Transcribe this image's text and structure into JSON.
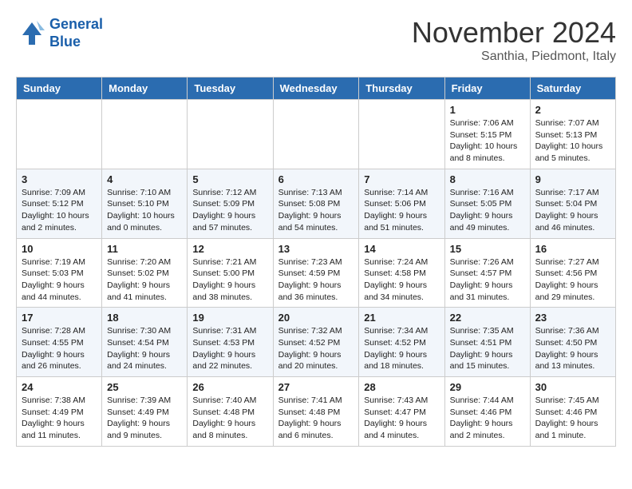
{
  "header": {
    "logo_line1": "General",
    "logo_line2": "Blue",
    "month_title": "November 2024",
    "location": "Santhia, Piedmont, Italy"
  },
  "days_of_week": [
    "Sunday",
    "Monday",
    "Tuesday",
    "Wednesday",
    "Thursday",
    "Friday",
    "Saturday"
  ],
  "weeks": [
    [
      {
        "day": "",
        "info": ""
      },
      {
        "day": "",
        "info": ""
      },
      {
        "day": "",
        "info": ""
      },
      {
        "day": "",
        "info": ""
      },
      {
        "day": "",
        "info": ""
      },
      {
        "day": "1",
        "info": "Sunrise: 7:06 AM\nSunset: 5:15 PM\nDaylight: 10 hours\nand 8 minutes."
      },
      {
        "day": "2",
        "info": "Sunrise: 7:07 AM\nSunset: 5:13 PM\nDaylight: 10 hours\nand 5 minutes."
      }
    ],
    [
      {
        "day": "3",
        "info": "Sunrise: 7:09 AM\nSunset: 5:12 PM\nDaylight: 10 hours\nand 2 minutes."
      },
      {
        "day": "4",
        "info": "Sunrise: 7:10 AM\nSunset: 5:10 PM\nDaylight: 10 hours\nand 0 minutes."
      },
      {
        "day": "5",
        "info": "Sunrise: 7:12 AM\nSunset: 5:09 PM\nDaylight: 9 hours\nand 57 minutes."
      },
      {
        "day": "6",
        "info": "Sunrise: 7:13 AM\nSunset: 5:08 PM\nDaylight: 9 hours\nand 54 minutes."
      },
      {
        "day": "7",
        "info": "Sunrise: 7:14 AM\nSunset: 5:06 PM\nDaylight: 9 hours\nand 51 minutes."
      },
      {
        "day": "8",
        "info": "Sunrise: 7:16 AM\nSunset: 5:05 PM\nDaylight: 9 hours\nand 49 minutes."
      },
      {
        "day": "9",
        "info": "Sunrise: 7:17 AM\nSunset: 5:04 PM\nDaylight: 9 hours\nand 46 minutes."
      }
    ],
    [
      {
        "day": "10",
        "info": "Sunrise: 7:19 AM\nSunset: 5:03 PM\nDaylight: 9 hours\nand 44 minutes."
      },
      {
        "day": "11",
        "info": "Sunrise: 7:20 AM\nSunset: 5:02 PM\nDaylight: 9 hours\nand 41 minutes."
      },
      {
        "day": "12",
        "info": "Sunrise: 7:21 AM\nSunset: 5:00 PM\nDaylight: 9 hours\nand 38 minutes."
      },
      {
        "day": "13",
        "info": "Sunrise: 7:23 AM\nSunset: 4:59 PM\nDaylight: 9 hours\nand 36 minutes."
      },
      {
        "day": "14",
        "info": "Sunrise: 7:24 AM\nSunset: 4:58 PM\nDaylight: 9 hours\nand 34 minutes."
      },
      {
        "day": "15",
        "info": "Sunrise: 7:26 AM\nSunset: 4:57 PM\nDaylight: 9 hours\nand 31 minutes."
      },
      {
        "day": "16",
        "info": "Sunrise: 7:27 AM\nSunset: 4:56 PM\nDaylight: 9 hours\nand 29 minutes."
      }
    ],
    [
      {
        "day": "17",
        "info": "Sunrise: 7:28 AM\nSunset: 4:55 PM\nDaylight: 9 hours\nand 26 minutes."
      },
      {
        "day": "18",
        "info": "Sunrise: 7:30 AM\nSunset: 4:54 PM\nDaylight: 9 hours\nand 24 minutes."
      },
      {
        "day": "19",
        "info": "Sunrise: 7:31 AM\nSunset: 4:53 PM\nDaylight: 9 hours\nand 22 minutes."
      },
      {
        "day": "20",
        "info": "Sunrise: 7:32 AM\nSunset: 4:52 PM\nDaylight: 9 hours\nand 20 minutes."
      },
      {
        "day": "21",
        "info": "Sunrise: 7:34 AM\nSunset: 4:52 PM\nDaylight: 9 hours\nand 18 minutes."
      },
      {
        "day": "22",
        "info": "Sunrise: 7:35 AM\nSunset: 4:51 PM\nDaylight: 9 hours\nand 15 minutes."
      },
      {
        "day": "23",
        "info": "Sunrise: 7:36 AM\nSunset: 4:50 PM\nDaylight: 9 hours\nand 13 minutes."
      }
    ],
    [
      {
        "day": "24",
        "info": "Sunrise: 7:38 AM\nSunset: 4:49 PM\nDaylight: 9 hours\nand 11 minutes."
      },
      {
        "day": "25",
        "info": "Sunrise: 7:39 AM\nSunset: 4:49 PM\nDaylight: 9 hours\nand 9 minutes."
      },
      {
        "day": "26",
        "info": "Sunrise: 7:40 AM\nSunset: 4:48 PM\nDaylight: 9 hours\nand 8 minutes."
      },
      {
        "day": "27",
        "info": "Sunrise: 7:41 AM\nSunset: 4:48 PM\nDaylight: 9 hours\nand 6 minutes."
      },
      {
        "day": "28",
        "info": "Sunrise: 7:43 AM\nSunset: 4:47 PM\nDaylight: 9 hours\nand 4 minutes."
      },
      {
        "day": "29",
        "info": "Sunrise: 7:44 AM\nSunset: 4:46 PM\nDaylight: 9 hours\nand 2 minutes."
      },
      {
        "day": "30",
        "info": "Sunrise: 7:45 AM\nSunset: 4:46 PM\nDaylight: 9 hours\nand 1 minute."
      }
    ]
  ]
}
